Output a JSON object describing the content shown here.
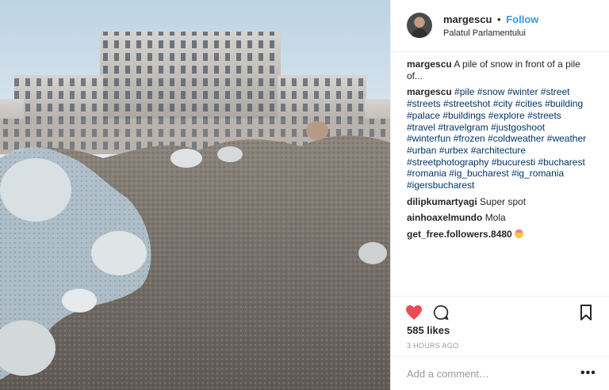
{
  "post": {
    "username": "margescu",
    "separator": "•",
    "follow_label": "Follow",
    "location": "Palatul Parlamentului",
    "photo_alt": "icon: building-photo"
  },
  "comments": [
    {
      "user": "margescu",
      "text": "A pile of snow in front of a pile of..."
    },
    {
      "user": "margescu",
      "text": "#pile #snow #winter #street #streets #streetshot #city #cities #building #palace #buildings #explore #streets #travel #travelgram #justgoshoot #winterfun #frozen #coldweather #weather #urban #urbex #architecture #streetphotography #bucuresti #bucharest #romania #ig_bucharest #ig_romania #igersbucharest"
    },
    {
      "user": "dilipkumartyagi",
      "text": "Super spot"
    },
    {
      "user": "ainhoaxelmundo",
      "text": "Mola"
    },
    {
      "user": "get_free.followers.8480",
      "text": ""
    }
  ],
  "actions": {
    "like_icon": "heart-icon",
    "comment_icon": "comment-icon",
    "save_icon": "bookmark-icon",
    "like_color": "#ed4956",
    "likes_text": "585 likes",
    "time_text": "3 HOURS AGO"
  },
  "add_comment": {
    "placeholder": "Add a comment…",
    "more_label": "•••"
  },
  "colors": {
    "link": "#3897f0",
    "hashtag": "#003569",
    "muted": "#999999"
  }
}
